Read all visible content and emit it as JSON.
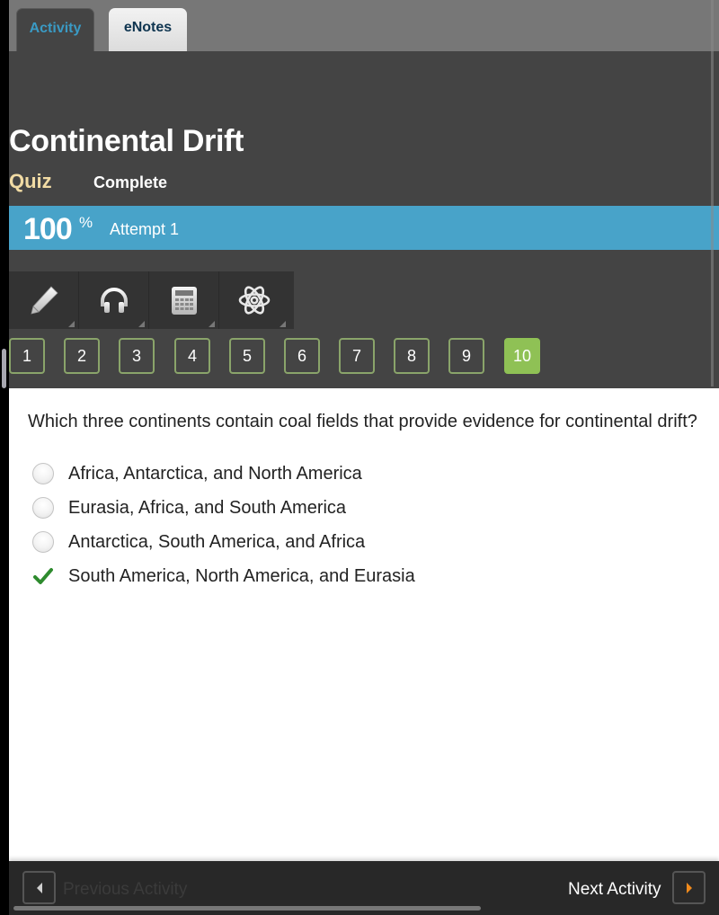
{
  "tabs": [
    {
      "label": "Activity",
      "active": true
    },
    {
      "label": "eNotes",
      "active": false
    }
  ],
  "header": {
    "title": "Continental Drift",
    "type_label": "Quiz",
    "status": "Complete"
  },
  "score": {
    "value": "100",
    "unit": "%",
    "attempt": "Attempt 1"
  },
  "toolbar": {
    "tools": [
      {
        "name": "pencil-icon",
        "label": "Pencil"
      },
      {
        "name": "headphones-icon",
        "label": "Audio"
      },
      {
        "name": "calculator-icon",
        "label": "Calculator"
      },
      {
        "name": "atom-icon",
        "label": "Reference"
      }
    ]
  },
  "question_nav": {
    "numbers": [
      "1",
      "2",
      "3",
      "4",
      "5",
      "6",
      "7",
      "8",
      "9",
      "10"
    ],
    "active": "10"
  },
  "question": {
    "text": "Which three continents contain coal fields that provide evidence for continental drift?",
    "answers": [
      {
        "text": "Africa, Antarctica, and North America",
        "selected": false
      },
      {
        "text": "Eurasia, Africa, and South America",
        "selected": false
      },
      {
        "text": "Antarctica, South America, and Africa",
        "selected": false
      },
      {
        "text": "South America, North America, and Eurasia",
        "selected": true,
        "correct": true
      }
    ]
  },
  "footer": {
    "prev_label": "Previous Activity",
    "next_label": "Next Activity"
  },
  "colors": {
    "accent_blue": "#48a3c9",
    "active_green": "#8fc155",
    "check_green": "#2e8b2e",
    "quiz_label": "#f1dba4",
    "next_arrow": "#f08a1c"
  }
}
